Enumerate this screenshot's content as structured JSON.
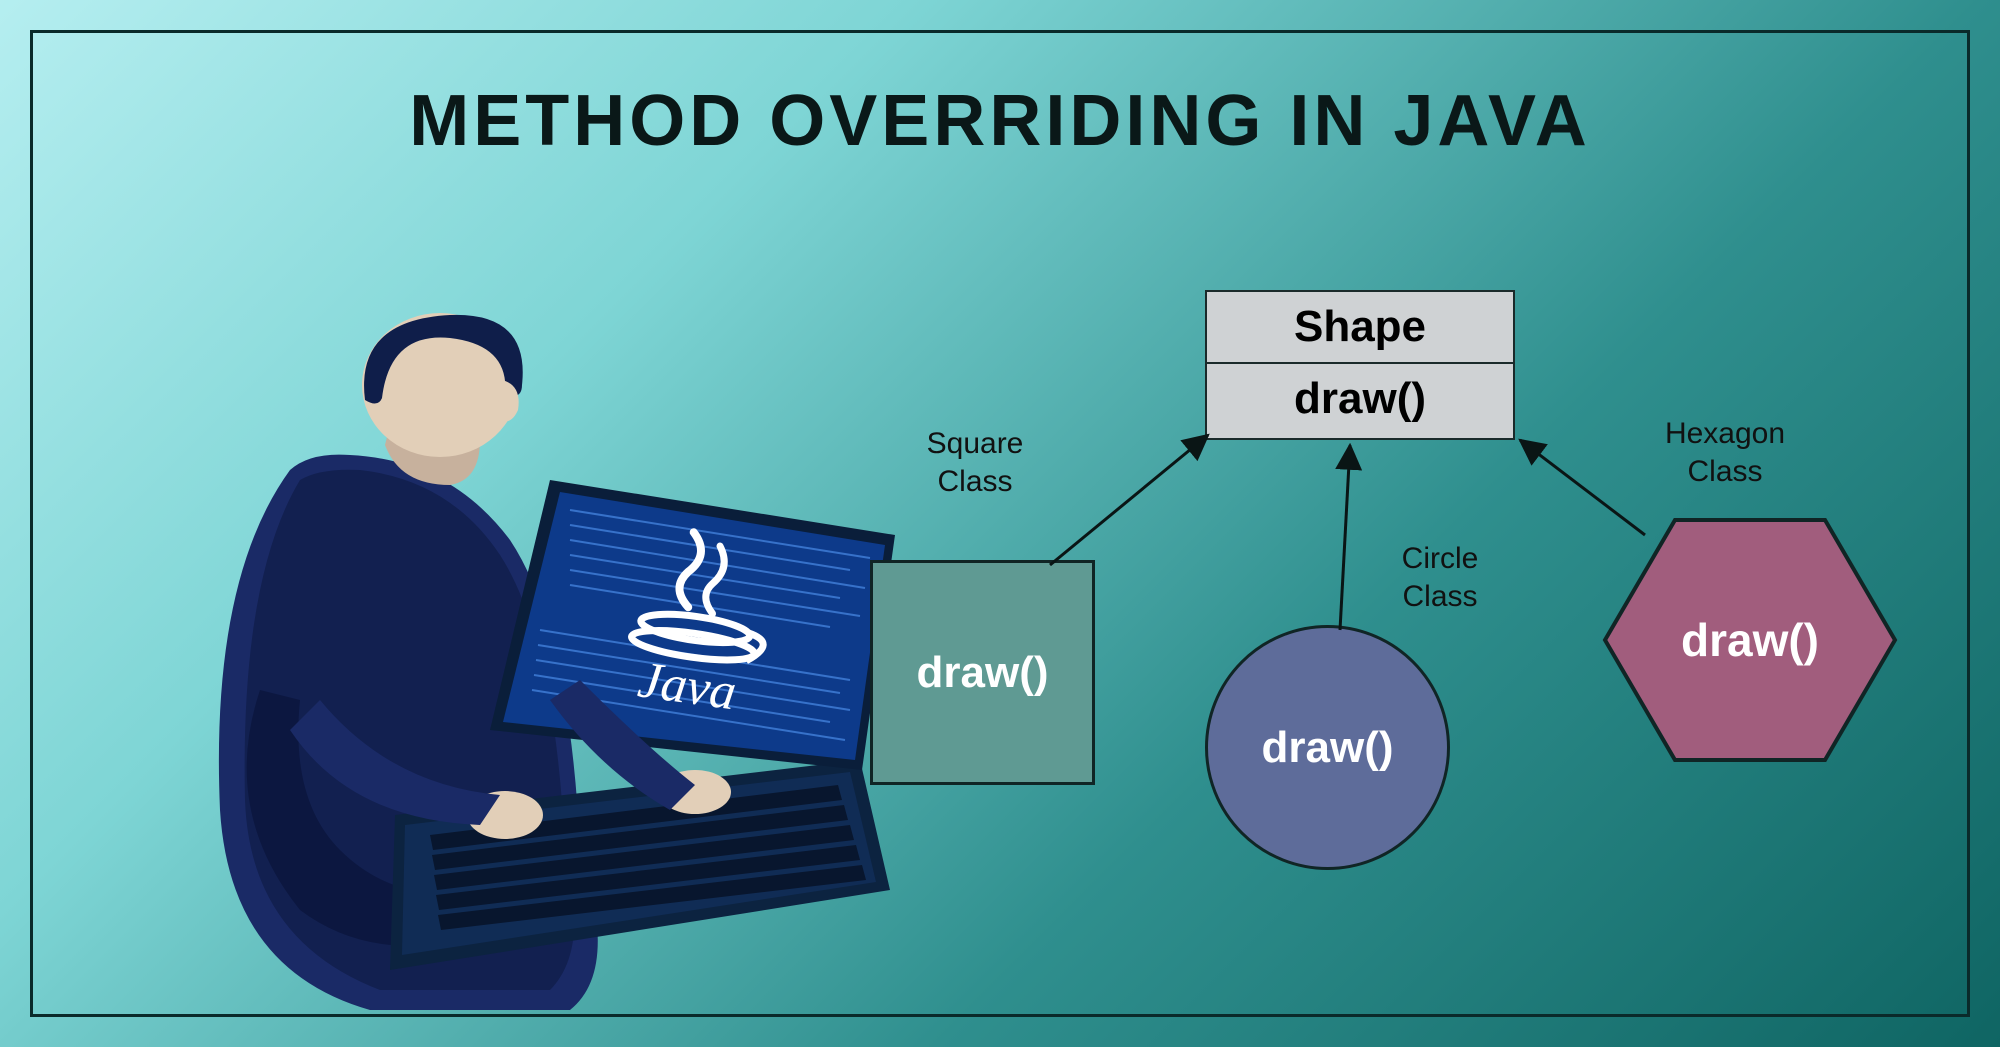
{
  "title": "METHOD OVERRIDING IN JAVA",
  "laptop_logo": "Java",
  "parent": {
    "name": "Shape",
    "method": "draw()"
  },
  "children": {
    "square": {
      "label": "Square Class",
      "method": "draw()"
    },
    "circle": {
      "label": "Circle Class",
      "method": "draw()"
    },
    "hexagon": {
      "label": "Hexagon Class",
      "method": "draw()"
    }
  },
  "colors": {
    "square": "#5f9a93",
    "circle": "#5e6c9a",
    "hexagon": "#a15d7d",
    "box_bg": "#cfd2d4"
  }
}
